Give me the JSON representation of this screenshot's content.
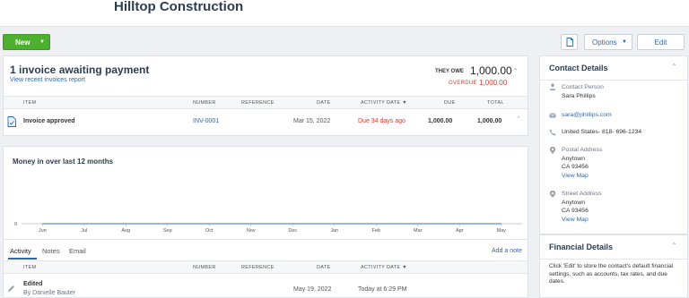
{
  "header": {
    "title": "Hilltop Construction"
  },
  "toolbar": {
    "new_label": "New",
    "options_label": "Options",
    "edit_label": "Edit"
  },
  "invoice": {
    "title": "1 invoice awaiting payment",
    "link": "View recent invoices report",
    "owe_label": "THEY OWE",
    "owe_value": "1,000.00",
    "overdue_label": "OVERDUE",
    "overdue_value": "1,000.00",
    "columns": [
      "ITEM",
      "NUMBER",
      "REFERENCE",
      "DATE",
      "ACTIVITY DATE ▼",
      "DUE",
      "TOTAL"
    ],
    "rows": [
      {
        "item": "Invoice approved",
        "number": "INV-0001",
        "reference": "",
        "date": "Mar 15, 2022",
        "activity": "Due 34 days ago",
        "due": "1,000.00",
        "total": "1,000.00"
      }
    ]
  },
  "chart_data": {
    "type": "line",
    "title": "Money in over last 12 months",
    "categories": [
      "Jun",
      "Jul",
      "Aug",
      "Sep",
      "Oct",
      "Nov",
      "Dec",
      "Jan",
      "Feb",
      "Mar",
      "Apr",
      "May"
    ],
    "values": [
      0,
      0,
      0,
      0,
      0,
      0,
      0,
      0,
      0,
      0,
      0,
      0
    ],
    "y_tick": "0",
    "xlabel": "",
    "ylabel": ""
  },
  "activity": {
    "tabs": [
      "Activity",
      "Notes",
      "Email"
    ],
    "add_note": "Add a note",
    "columns": [
      "ITEM",
      "NUMBER",
      "REFERENCE",
      "DATE",
      "ACTIVITY DATE ▼"
    ],
    "rows": [
      {
        "item": "Edited",
        "by": "By Danielle Bauter",
        "date": "May 19, 2022",
        "activity": "Today at 6:29 PM"
      }
    ]
  },
  "contact": {
    "title": "Contact Details",
    "person_label": "Contact Person",
    "person_name": "Sara  Phillips",
    "email": "sara@phillips.com",
    "phone": "United States- 818- 696-1234",
    "postal_label": "Postal Address",
    "postal_line1": "Anytown",
    "postal_line2": "CA 93456",
    "postal_map": "View Map",
    "street_label": "Street Address",
    "street_line1": "Anytown",
    "street_line2": "CA 93456",
    "street_map": "View Map"
  },
  "financial": {
    "title": "Financial Details",
    "text": "Click 'Edit' to store the contact's default financial settings, such as accounts, tax rates, and due dates."
  },
  "colors": {
    "brand_green": "#4caf2d",
    "link_blue": "#2a6aad",
    "overdue_red": "#d83a2e",
    "heading": "#2c3e50"
  }
}
